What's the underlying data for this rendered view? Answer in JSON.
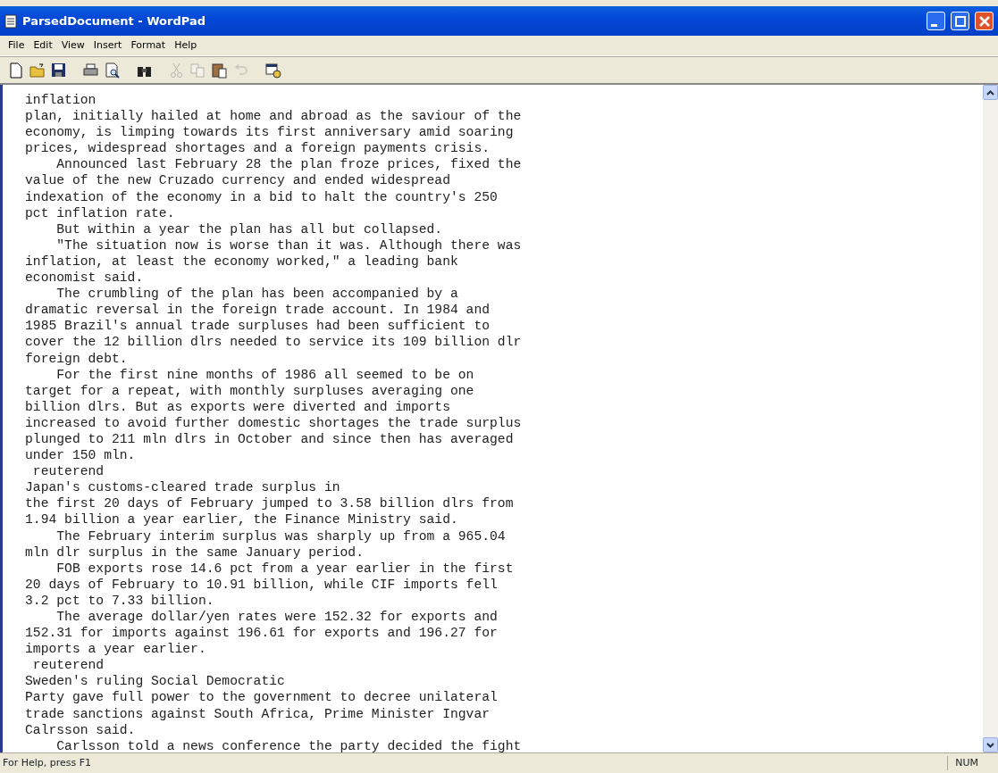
{
  "window": {
    "title": "ParsedDocument - WordPad"
  },
  "menu": [
    "File",
    "Edit",
    "View",
    "Insert",
    "Format",
    "Help"
  ],
  "toolbar": [
    {
      "kind": "new",
      "disabled": false
    },
    {
      "kind": "open",
      "disabled": false
    },
    {
      "kind": "save",
      "disabled": false
    },
    {
      "kind": "sep"
    },
    {
      "kind": "print",
      "disabled": false
    },
    {
      "kind": "preview",
      "disabled": false
    },
    {
      "kind": "sep"
    },
    {
      "kind": "find",
      "disabled": false
    },
    {
      "kind": "sep"
    },
    {
      "kind": "cut",
      "disabled": true
    },
    {
      "kind": "copy",
      "disabled": true
    },
    {
      "kind": "paste",
      "disabled": false
    },
    {
      "kind": "undo",
      "disabled": true
    },
    {
      "kind": "sep"
    },
    {
      "kind": "datetime",
      "disabled": false
    }
  ],
  "document": {
    "lines": [
      "inflation",
      "plan, initially hailed at home and abroad as the saviour of the",
      "economy, is limping towards its first anniversary amid soaring",
      "prices, widespread shortages and a foreign payments crisis.",
      "    Announced last February 28 the plan froze prices, fixed the",
      "value of the new Cruzado currency and ended widespread",
      "indexation of the economy in a bid to halt the country's 250",
      "pct inflation rate.",
      "    But within a year the plan has all but collapsed.",
      "    \"The situation now is worse than it was. Although there was",
      "inflation, at least the economy worked,\" a leading bank",
      "economist said.",
      "    The crumbling of the plan has been accompanied by a",
      "dramatic reversal in the foreign trade account. In 1984 and",
      "1985 Brazil's annual trade surpluses had been sufficient to",
      "cover the 12 billion dlrs needed to service its 109 billion dlr",
      "foreign debt.",
      "    For the first nine months of 1986 all seemed to be on",
      "target for a repeat, with monthly surpluses averaging one",
      "billion dlrs. But as exports were diverted and imports",
      "increased to avoid further domestic shortages the trade surplus",
      "plunged to 211 mln dlrs in October and since then has averaged",
      "under 150 mln.",
      " reuterend",
      "Japan's customs-cleared trade surplus in",
      "the first 20 days of February jumped to 3.58 billion dlrs from",
      "1.94 billion a year earlier, the Finance Ministry said.",
      "    The February interim surplus was sharply up from a 965.04",
      "mln dlr surplus in the same January period.",
      "    FOB exports rose 14.6 pct from a year earlier in the first",
      "20 days of February to 10.91 billion, while CIF imports fell",
      "3.2 pct to 7.33 billion.",
      "    The average dollar/yen rates were 152.32 for exports and",
      "152.31 for imports against 196.61 for exports and 196.27 for",
      "imports a year earlier.",
      " reuterend",
      "Sweden's ruling Social Democratic",
      "Party gave full power to the government to decree unilateral",
      "trade sanctions against South Africa, Prime Minister Ingvar",
      "Calrsson said.",
      "    Carlsson told a news conference the party decided the fight"
    ]
  },
  "status_bar": {
    "help": "For Help, press F1",
    "indicator": "NUM"
  }
}
